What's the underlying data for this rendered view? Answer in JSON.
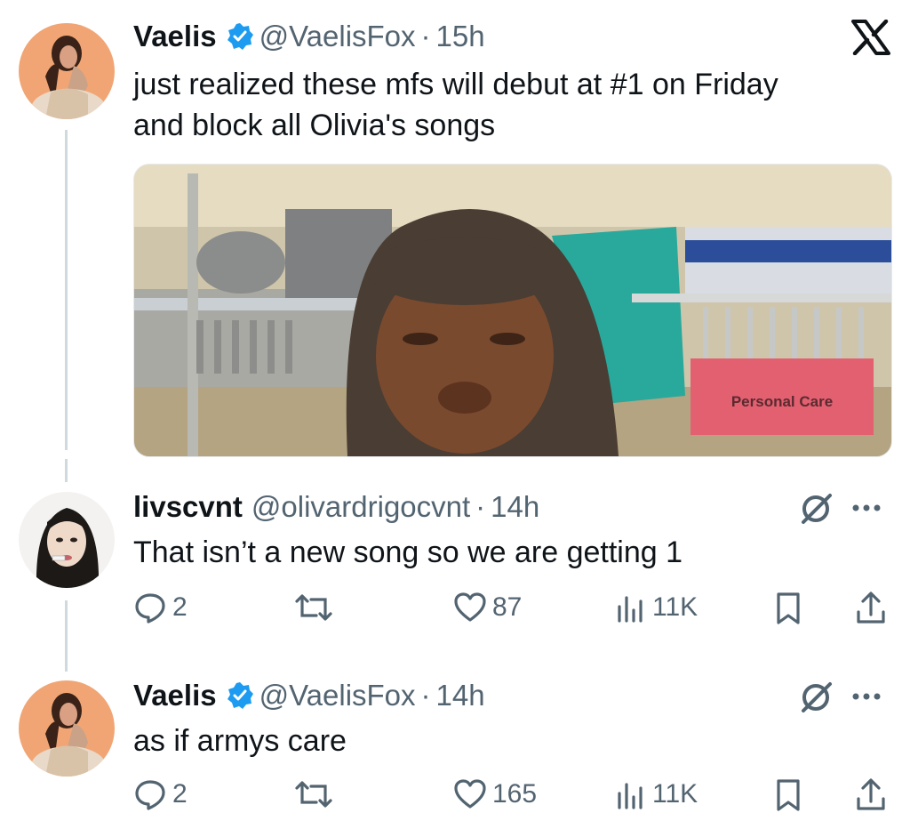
{
  "top_tweet": {
    "name": "Vaelis",
    "handle": "@VaelisFox",
    "separator": "·",
    "time": "15h",
    "text_line1": "just realized these mfs will debut at #1 on Friday",
    "text_line2": "and block all Olivia's songs",
    "media_sign": "Personal Care"
  },
  "reply1": {
    "name": "livscvnt",
    "handle": "@olivardrigocvnt",
    "separator": "·",
    "time": "14h",
    "text": "That isn’t a new song so we are getting 1",
    "replies": "2",
    "likes": "87",
    "views": "11K"
  },
  "reply2": {
    "name": "Vaelis",
    "handle": "@VaelisFox",
    "separator": "·",
    "time": "14h",
    "text": "as if armys care",
    "replies": "2",
    "likes": "165",
    "views": "11K"
  },
  "colors": {
    "verified": "#1d9bf0",
    "muted": "#536471",
    "text": "#0f1419",
    "thread_line": "#cfd9de",
    "avatar_bg": "#f0a070"
  },
  "icons": [
    "x-logo-icon",
    "verified-badge-icon",
    "grok-icon",
    "more-icon",
    "reply-icon",
    "repost-icon",
    "like-icon",
    "views-icon",
    "bookmark-icon",
    "share-icon"
  ]
}
